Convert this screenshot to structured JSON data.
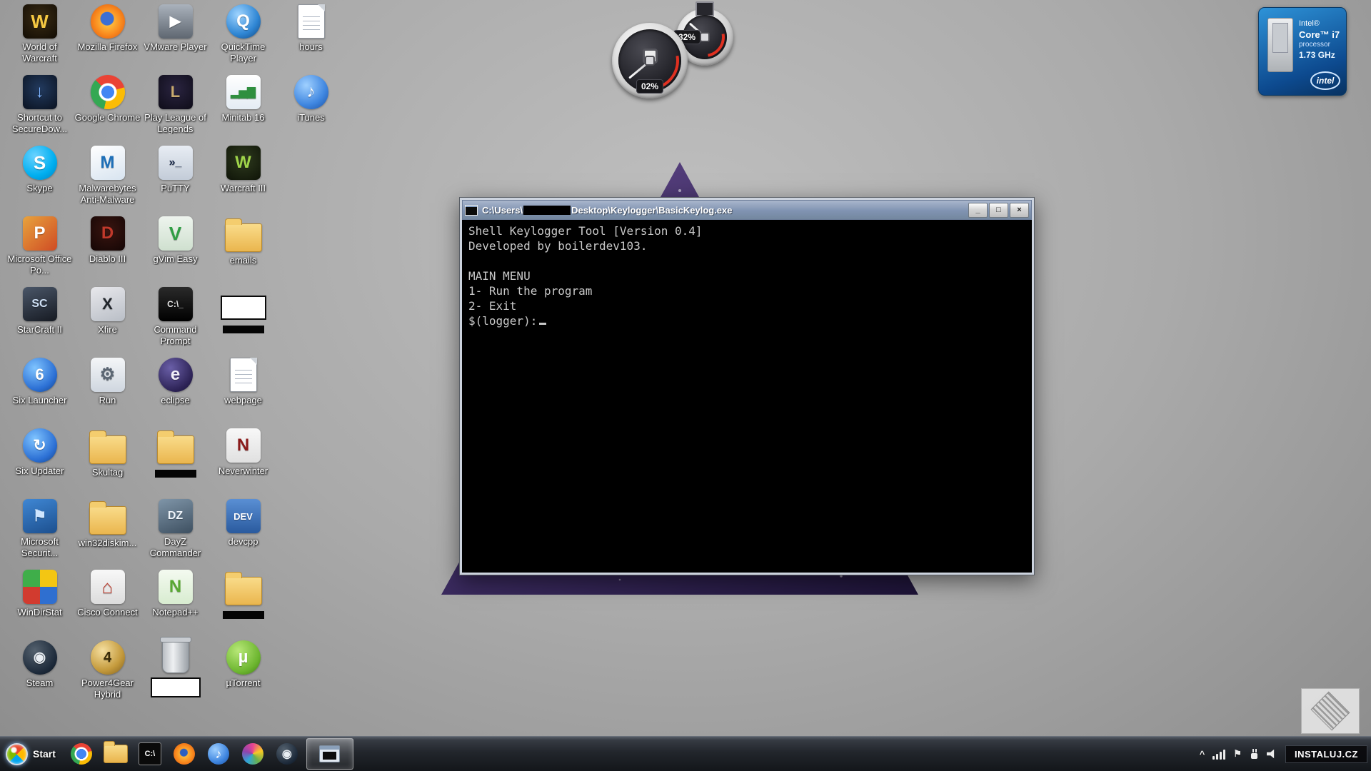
{
  "desktop": {
    "icons": [
      {
        "id": "world-of-warcraft",
        "label": "World of Warcraft",
        "col": 0,
        "row": 0,
        "type": "tile",
        "bg": "radial-gradient(circle at 50% 40%, #3a2c14, #120c04)",
        "glyph": "W",
        "fg": "#f5c842",
        "glyph_size": 26
      },
      {
        "id": "shortcut-securedow",
        "label": "Shortcut to SecureDow...",
        "col": 0,
        "row": 1,
        "type": "tile",
        "bg": "radial-gradient(circle at 50% 40%, #223a5e, #0a1220)",
        "glyph": "↓",
        "fg": "#7fb4ff",
        "glyph_size": 24
      },
      {
        "id": "skype",
        "label": "Skype",
        "col": 0,
        "row": 2,
        "type": "circle",
        "bg": "radial-gradient(circle at 35% 30%, #6ad2ff, #00aff0 60%, #0080c0)",
        "glyph": "S",
        "fg": "#ffffff",
        "glyph_size": 26
      },
      {
        "id": "microsoft-office-po",
        "label": "Microsoft Office Po...",
        "col": 0,
        "row": 3,
        "type": "tile",
        "bg": "linear-gradient(135deg, #e8a33d, #cf4b24)",
        "glyph": "P",
        "fg": "#ffffff",
        "glyph_size": 24
      },
      {
        "id": "starcraft-ii",
        "label": "StarCraft II",
        "col": 0,
        "row": 4,
        "type": "tile",
        "bg": "linear-gradient(160deg, #4a5668, #161a22)",
        "glyph": "SC",
        "fg": "#cfe0f5",
        "glyph_size": 16
      },
      {
        "id": "six-launcher",
        "label": "Six Launcher",
        "col": 0,
        "row": 5,
        "type": "circle",
        "bg": "radial-gradient(circle at 35% 30%, #7fc4ff, #2b6fd4 65%, #15407e)",
        "glyph": "6",
        "fg": "#ffffff",
        "glyph_size": 22
      },
      {
        "id": "six-updater",
        "label": "Six Updater",
        "col": 0,
        "row": 6,
        "type": "circle",
        "bg": "radial-gradient(circle at 35% 30%, #7fc4ff, #2b6fd4 65%, #15407e)",
        "glyph": "↻",
        "fg": "#ffffff",
        "glyph_size": 22
      },
      {
        "id": "microsoft-securit",
        "label": "Microsoft Securit...",
        "col": 0,
        "row": 7,
        "type": "tile",
        "bg": "linear-gradient(160deg, #3f87d4, #1c4f8e)",
        "glyph": "⚑",
        "fg": "#cfe6ff",
        "glyph_size": 22
      },
      {
        "id": "windirstat",
        "label": "WinDirStat",
        "col": 0,
        "row": 8,
        "type": "tile",
        "bg": "conic-gradient(from 0deg, #f3c613 0 25%, #2f6fd0 0 50%, #d23b2f 0 75%, #3fae4a 0)",
        "glyph": "",
        "fg": ""
      },
      {
        "id": "steam",
        "label": "Steam",
        "col": 0,
        "row": 9,
        "type": "circle",
        "bg": "radial-gradient(circle at 35% 30%, #54616e, #1b2838 70%, #0e141c)",
        "glyph": "◉",
        "fg": "#e8edf2",
        "glyph_size": 20
      },
      {
        "id": "mozilla-firefox",
        "label": "Mozilla Firefox",
        "col": 1,
        "row": 0,
        "type": "circle",
        "bg": "radial-gradient(circle at 48% 42%, #3b6fd4 0 9px, rgba(0,0,0,0) 10px), radial-gradient(circle at 50% 50%, #ffd24a, #f98a1e 55%, #d94f0e)",
        "glyph": "",
        "fg": ""
      },
      {
        "id": "google-chrome",
        "label": "Google Chrome",
        "col": 1,
        "row": 1,
        "type": "circle",
        "bg": "radial-gradient(circle at 50% 50%, #4285f4 0 9px, #ffffff 9px 12px, rgba(0,0,0,0) 13px), conic-gradient(from -45deg, #ea4335 0 33%, #fbbc05 0 66%, #34a853 0)",
        "glyph": "",
        "fg": ""
      },
      {
        "id": "malwarebytes",
        "label": "Malwarebytes Anti-Malware",
        "col": 1,
        "row": 2,
        "type": "tile",
        "bg": "linear-gradient(160deg, #ffffff, #d8e4f0)",
        "glyph": "M",
        "fg": "#1d6fb8",
        "glyph_size": 24
      },
      {
        "id": "diablo-iii",
        "label": "Diablo III",
        "col": 1,
        "row": 3,
        "type": "tile",
        "bg": "radial-gradient(circle at 50% 40%, #3a1510, #140605)",
        "glyph": "D",
        "fg": "#c0392b",
        "glyph_size": 24
      },
      {
        "id": "xfire",
        "label": "Xfire",
        "col": 1,
        "row": 4,
        "type": "tile",
        "bg": "linear-gradient(160deg, #e8e8ec, #b9bec6)",
        "glyph": "X",
        "fg": "#22262c",
        "glyph_size": 22
      },
      {
        "id": "run",
        "label": "Run",
        "col": 1,
        "row": 5,
        "type": "tile",
        "bg": "linear-gradient(180deg, #f4f6f8, #cfd6df)",
        "glyph": "⚙",
        "fg": "#5a6572",
        "glyph_size": 24
      },
      {
        "id": "skultag",
        "label": "Skultag",
        "col": 1,
        "row": 6,
        "type": "folder"
      },
      {
        "id": "win32diskim",
        "label": "win32diskim...",
        "col": 1,
        "row": 7,
        "type": "folder"
      },
      {
        "id": "cisco-connect",
        "label": "Cisco Connect",
        "col": 1,
        "row": 8,
        "type": "tile",
        "bg": "linear-gradient(180deg, #f8f8f8, #dcdcdc)",
        "glyph": "⌂",
        "fg": "#c03a2b",
        "glyph_size": 26
      },
      {
        "id": "power4gear-hybrid",
        "label": "Power4Gear Hybrid",
        "col": 1,
        "row": 9,
        "type": "circle",
        "bg": "radial-gradient(circle at 35% 30%, #f5dfa0, #c49a3c 60%, #7e5d1c)",
        "glyph": "4",
        "fg": "#3a2c08",
        "glyph_size": 20
      },
      {
        "id": "vmware-player",
        "label": "VMware Player",
        "col": 2,
        "row": 0,
        "type": "tile",
        "bg": "linear-gradient(180deg, #aab2bc, #5f6771)",
        "glyph": "▶",
        "fg": "#ffffff",
        "glyph_size": 20
      },
      {
        "id": "play-league-of-legends",
        "label": "Play League of Legends",
        "col": 2,
        "row": 1,
        "type": "tile",
        "bg": "radial-gradient(circle at 50% 40%, #2a2440, #0e0c18)",
        "glyph": "L",
        "fg": "#c8aa6e",
        "glyph_size": 22
      },
      {
        "id": "putty",
        "label": "PuTTY",
        "col": 2,
        "row": 2,
        "type": "tile",
        "bg": "linear-gradient(180deg, #e8edf4, #c3ccd8)",
        "glyph": "»_",
        "fg": "#1a2a4a",
        "glyph_size": 16
      },
      {
        "id": "gvim-easy",
        "label": "gVim Easy",
        "col": 2,
        "row": 3,
        "type": "tile",
        "bg": "linear-gradient(180deg, #eef4ee, #cfe0cf)",
        "glyph": "V",
        "fg": "#2f9e44",
        "glyph_size": 26
      },
      {
        "id": "command-prompt",
        "label": "Command Prompt",
        "col": 2,
        "row": 4,
        "type": "tile",
        "bg": "linear-gradient(180deg, #2a2a2a, #000000)",
        "glyph": "C:\\_",
        "fg": "#e8e8e8",
        "glyph_size": 12
      },
      {
        "id": "eclipse",
        "label": "eclipse",
        "col": 2,
        "row": 5,
        "type": "circle",
        "bg": "radial-gradient(circle at 35% 30%, #6a5fa8, #2c2255 70%, #171133)",
        "glyph": "e",
        "fg": "#f0eef8",
        "glyph_size": 24
      },
      {
        "id": "redacted-folder-1",
        "label": "",
        "col": 2,
        "row": 6,
        "type": "folder",
        "label_style": "black-bar"
      },
      {
        "id": "dayz-commander",
        "label": "DayZ Commander",
        "col": 2,
        "row": 7,
        "type": "tile",
        "bg": "linear-gradient(160deg, #7f95a8, #3d4f60)",
        "glyph": "DZ",
        "fg": "#eef4fa",
        "glyph_size": 16
      },
      {
        "id": "notepad-plus-plus",
        "label": "Notepad++",
        "col": 2,
        "row": 8,
        "type": "tile",
        "bg": "linear-gradient(180deg, #f4faf0, #d8ecd0)",
        "glyph": "N",
        "fg": "#58a832",
        "glyph_size": 24
      },
      {
        "id": "recycle-bin",
        "label": "",
        "col": 2,
        "row": 9,
        "type": "trash",
        "label_style": "white-box"
      },
      {
        "id": "quicktime-player",
        "label": "QuickTime Player",
        "col": 3,
        "row": 0,
        "type": "circle",
        "bg": "radial-gradient(circle at 35% 30%, #9fd4ff, #2f86d4 60%, #10457e)",
        "glyph": "Q",
        "fg": "#ffffff",
        "glyph_size": 24
      },
      {
        "id": "minitab-16",
        "label": "Minitab 16",
        "col": 3,
        "row": 1,
        "type": "tile",
        "bg": "linear-gradient(180deg, #ffffff, #e4ecf4)",
        "glyph": "▂▅▇",
        "fg": "#2f8f3f",
        "glyph_size": 15
      },
      {
        "id": "warcraft-iii",
        "label": "Warcraft III",
        "col": 3,
        "row": 2,
        "type": "tile",
        "bg": "radial-gradient(circle at 50% 40%, #2e3a1e, #0f1408)",
        "glyph": "W",
        "fg": "#9fd44a",
        "glyph_size": 24
      },
      {
        "id": "emails",
        "label": "emails",
        "col": 3,
        "row": 3,
        "type": "folder"
      },
      {
        "id": "redacted-item-1",
        "label": "",
        "col": 3,
        "row": 4,
        "type": "redacted",
        "label_style": "black-bar"
      },
      {
        "id": "webpage",
        "label": "webpage",
        "col": 3,
        "row": 5,
        "type": "file"
      },
      {
        "id": "neverwinter",
        "label": "Neverwinter",
        "col": 3,
        "row": 6,
        "type": "tile",
        "bg": "linear-gradient(180deg, #f8f8f8, #e0e0e0)",
        "glyph": "N",
        "fg": "#8b1a1a",
        "glyph_size": 24
      },
      {
        "id": "devcpp",
        "label": "devcpp",
        "col": 3,
        "row": 7,
        "type": "tile",
        "bg": "linear-gradient(180deg, #5a8fd4, #2a5a9e)",
        "glyph": "DEV",
        "fg": "#ffffff",
        "glyph_size": 13
      },
      {
        "id": "redacted-folder-2",
        "label": "",
        "col": 3,
        "row": 8,
        "type": "folder",
        "label_style": "black-bar"
      },
      {
        "id": "utorrent",
        "label": "µTorrent",
        "col": 3,
        "row": 9,
        "type": "circle",
        "bg": "radial-gradient(circle at 35% 30%, #b8e878, #6cb52f 65%, #3f7a14)",
        "glyph": "µ",
        "fg": "#ffffff",
        "glyph_size": 24
      },
      {
        "id": "hours",
        "label": "hours",
        "col": 4,
        "row": 0,
        "type": "file"
      },
      {
        "id": "itunes",
        "label": "iTunes",
        "col": 4,
        "row": 1,
        "type": "circle",
        "bg": "radial-gradient(circle at 35% 30%, #9fd0ff, #3f86e0 60%, #1a4fa0)",
        "glyph": "♪",
        "fg": "#ffffff",
        "glyph_size": 24
      }
    ]
  },
  "gadgets": {
    "cpu": {
      "label": "02%",
      "pct": 2
    },
    "ram": {
      "label": "32%",
      "pct": 32
    },
    "intel": {
      "brand": "Intel®",
      "model": "Core™ i7",
      "kind": "processor",
      "speed": "1.73 GHz",
      "logo_text": "intel"
    }
  },
  "console": {
    "title_prefix": "C:\\Users\\",
    "title_suffix": "Desktop\\Keylogger\\BasicKeylog.exe",
    "buttons": {
      "minimize": "_",
      "maximize": "□",
      "close": "×"
    },
    "lines": [
      "Shell Keylogger Tool [Version 0.4]",
      "Developed by boilerdev103.",
      "",
      "MAIN MENU",
      "1- Run the program",
      "2- Exit",
      "$(logger):"
    ]
  },
  "taskbar": {
    "start_label": "Start",
    "apps": [
      {
        "id": "chrome"
      },
      {
        "id": "explorer"
      },
      {
        "id": "cmd",
        "glyph": "C:\\",
        "fg": "#ffffff"
      },
      {
        "id": "firefox"
      },
      {
        "id": "itunes",
        "glyph": "♪",
        "fg": "#ffffff"
      },
      {
        "id": "media-app"
      },
      {
        "id": "steam",
        "glyph": "◉",
        "fg": "#e8edf2"
      }
    ],
    "tray": {
      "expand_glyph": "^",
      "flag_glyph": "⚑",
      "watermark": "INSTALUJ.CZ"
    }
  }
}
